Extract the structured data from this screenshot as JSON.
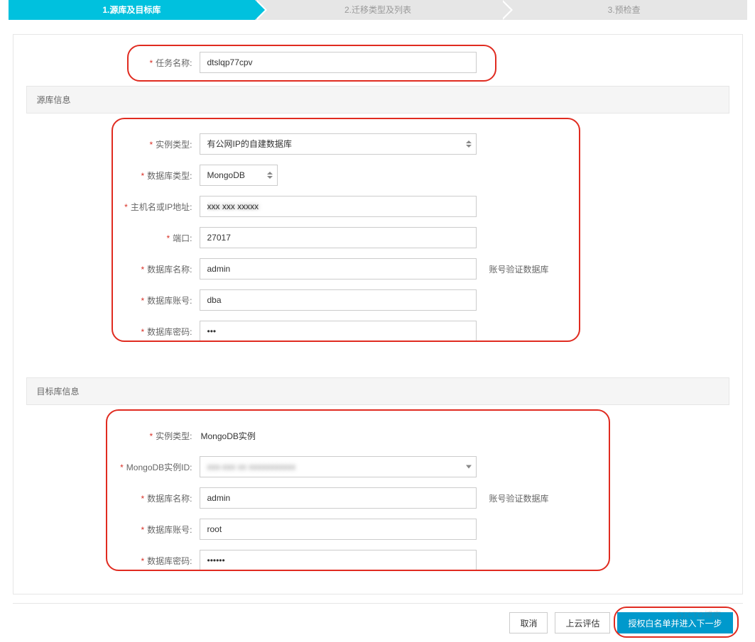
{
  "steps": {
    "s1": "1.源库及目标库",
    "s2": "2.迁移类型及列表",
    "s3": "3.预检查"
  },
  "task": {
    "label": "任务名称:",
    "value": "dtslqp77cpv"
  },
  "source": {
    "title": "源库信息",
    "instance_type_label": "实例类型:",
    "instance_type_value": "有公网IP的自建数据库",
    "db_type_label": "数据库类型:",
    "db_type_value": "MongoDB",
    "host_label": "主机名或IP地址:",
    "host_value": "",
    "port_label": "端口:",
    "port_value": "27017",
    "db_name_label": "数据库名称:",
    "db_name_value": "admin",
    "db_name_hint": "账号验证数据库",
    "account_label": "数据库账号:",
    "account_value": "dba",
    "password_label": "数据库密码:",
    "password_value": "•••"
  },
  "target": {
    "title": "目标库信息",
    "instance_type_label": "实例类型:",
    "instance_type_value": "MongoDB实例",
    "instance_id_label": "MongoDB实例ID:",
    "instance_id_value": "",
    "db_name_label": "数据库名称:",
    "db_name_value": "admin",
    "db_name_hint": "账号验证数据库",
    "account_label": "数据库账号:",
    "account_value": "root",
    "password_label": "数据库密码:",
    "password_value": "••••••"
  },
  "footer": {
    "cancel": "取消",
    "evaluate": "上云评估",
    "next": "授权白名单并进入下一步"
  },
  "watermark": "51CTO博客"
}
